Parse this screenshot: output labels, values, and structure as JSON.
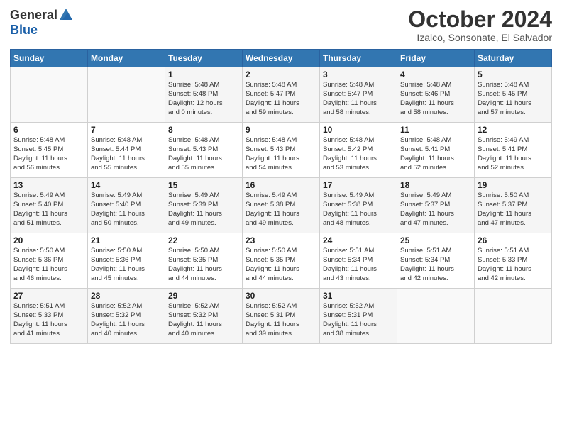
{
  "logo": {
    "general": "General",
    "blue": "Blue"
  },
  "header": {
    "month": "October 2024",
    "location": "Izalco, Sonsonate, El Salvador"
  },
  "columns": [
    "Sunday",
    "Monday",
    "Tuesday",
    "Wednesday",
    "Thursday",
    "Friday",
    "Saturday"
  ],
  "weeks": [
    [
      {
        "day": "",
        "info": ""
      },
      {
        "day": "",
        "info": ""
      },
      {
        "day": "1",
        "info": "Sunrise: 5:48 AM\nSunset: 5:48 PM\nDaylight: 12 hours\nand 0 minutes."
      },
      {
        "day": "2",
        "info": "Sunrise: 5:48 AM\nSunset: 5:47 PM\nDaylight: 11 hours\nand 59 minutes."
      },
      {
        "day": "3",
        "info": "Sunrise: 5:48 AM\nSunset: 5:47 PM\nDaylight: 11 hours\nand 58 minutes."
      },
      {
        "day": "4",
        "info": "Sunrise: 5:48 AM\nSunset: 5:46 PM\nDaylight: 11 hours\nand 58 minutes."
      },
      {
        "day": "5",
        "info": "Sunrise: 5:48 AM\nSunset: 5:45 PM\nDaylight: 11 hours\nand 57 minutes."
      }
    ],
    [
      {
        "day": "6",
        "info": "Sunrise: 5:48 AM\nSunset: 5:45 PM\nDaylight: 11 hours\nand 56 minutes."
      },
      {
        "day": "7",
        "info": "Sunrise: 5:48 AM\nSunset: 5:44 PM\nDaylight: 11 hours\nand 55 minutes."
      },
      {
        "day": "8",
        "info": "Sunrise: 5:48 AM\nSunset: 5:43 PM\nDaylight: 11 hours\nand 55 minutes."
      },
      {
        "day": "9",
        "info": "Sunrise: 5:48 AM\nSunset: 5:43 PM\nDaylight: 11 hours\nand 54 minutes."
      },
      {
        "day": "10",
        "info": "Sunrise: 5:48 AM\nSunset: 5:42 PM\nDaylight: 11 hours\nand 53 minutes."
      },
      {
        "day": "11",
        "info": "Sunrise: 5:48 AM\nSunset: 5:41 PM\nDaylight: 11 hours\nand 52 minutes."
      },
      {
        "day": "12",
        "info": "Sunrise: 5:49 AM\nSunset: 5:41 PM\nDaylight: 11 hours\nand 52 minutes."
      }
    ],
    [
      {
        "day": "13",
        "info": "Sunrise: 5:49 AM\nSunset: 5:40 PM\nDaylight: 11 hours\nand 51 minutes."
      },
      {
        "day": "14",
        "info": "Sunrise: 5:49 AM\nSunset: 5:40 PM\nDaylight: 11 hours\nand 50 minutes."
      },
      {
        "day": "15",
        "info": "Sunrise: 5:49 AM\nSunset: 5:39 PM\nDaylight: 11 hours\nand 49 minutes."
      },
      {
        "day": "16",
        "info": "Sunrise: 5:49 AM\nSunset: 5:38 PM\nDaylight: 11 hours\nand 49 minutes."
      },
      {
        "day": "17",
        "info": "Sunrise: 5:49 AM\nSunset: 5:38 PM\nDaylight: 11 hours\nand 48 minutes."
      },
      {
        "day": "18",
        "info": "Sunrise: 5:49 AM\nSunset: 5:37 PM\nDaylight: 11 hours\nand 47 minutes."
      },
      {
        "day": "19",
        "info": "Sunrise: 5:50 AM\nSunset: 5:37 PM\nDaylight: 11 hours\nand 47 minutes."
      }
    ],
    [
      {
        "day": "20",
        "info": "Sunrise: 5:50 AM\nSunset: 5:36 PM\nDaylight: 11 hours\nand 46 minutes."
      },
      {
        "day": "21",
        "info": "Sunrise: 5:50 AM\nSunset: 5:36 PM\nDaylight: 11 hours\nand 45 minutes."
      },
      {
        "day": "22",
        "info": "Sunrise: 5:50 AM\nSunset: 5:35 PM\nDaylight: 11 hours\nand 44 minutes."
      },
      {
        "day": "23",
        "info": "Sunrise: 5:50 AM\nSunset: 5:35 PM\nDaylight: 11 hours\nand 44 minutes."
      },
      {
        "day": "24",
        "info": "Sunrise: 5:51 AM\nSunset: 5:34 PM\nDaylight: 11 hours\nand 43 minutes."
      },
      {
        "day": "25",
        "info": "Sunrise: 5:51 AM\nSunset: 5:34 PM\nDaylight: 11 hours\nand 42 minutes."
      },
      {
        "day": "26",
        "info": "Sunrise: 5:51 AM\nSunset: 5:33 PM\nDaylight: 11 hours\nand 42 minutes."
      }
    ],
    [
      {
        "day": "27",
        "info": "Sunrise: 5:51 AM\nSunset: 5:33 PM\nDaylight: 11 hours\nand 41 minutes."
      },
      {
        "day": "28",
        "info": "Sunrise: 5:52 AM\nSunset: 5:32 PM\nDaylight: 11 hours\nand 40 minutes."
      },
      {
        "day": "29",
        "info": "Sunrise: 5:52 AM\nSunset: 5:32 PM\nDaylight: 11 hours\nand 40 minutes."
      },
      {
        "day": "30",
        "info": "Sunrise: 5:52 AM\nSunset: 5:31 PM\nDaylight: 11 hours\nand 39 minutes."
      },
      {
        "day": "31",
        "info": "Sunrise: 5:52 AM\nSunset: 5:31 PM\nDaylight: 11 hours\nand 38 minutes."
      },
      {
        "day": "",
        "info": ""
      },
      {
        "day": "",
        "info": ""
      }
    ]
  ]
}
